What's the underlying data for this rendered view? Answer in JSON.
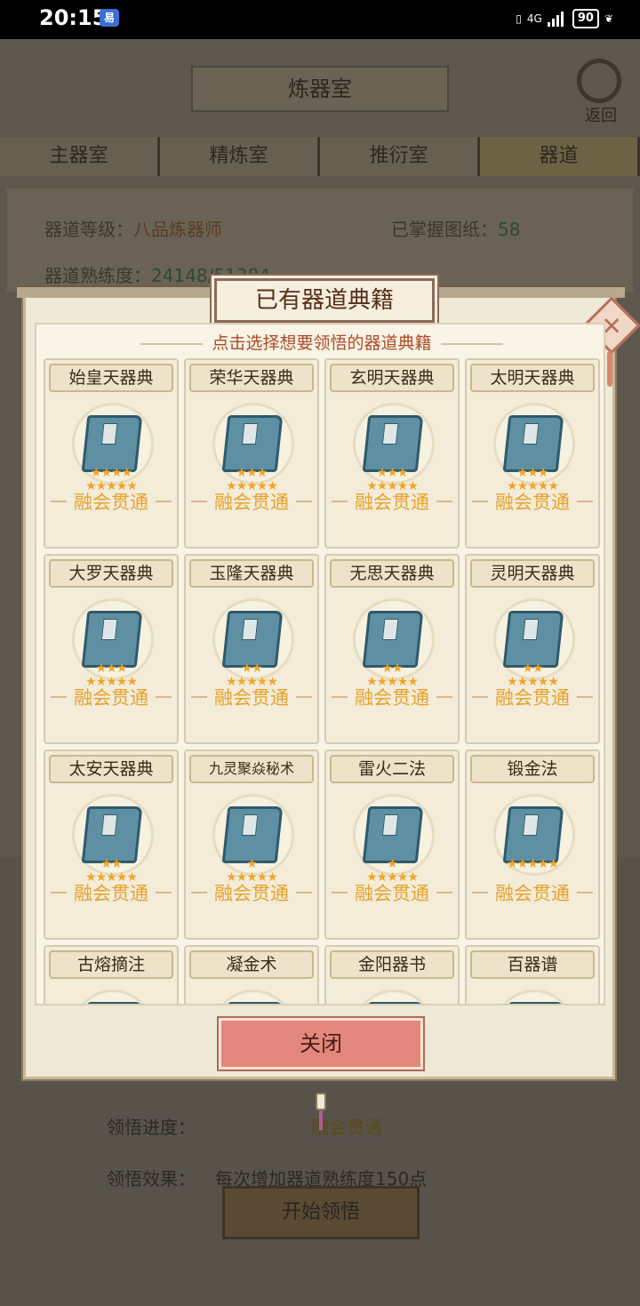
{
  "status_bar": {
    "time": "20:15",
    "app_badge": "易",
    "network": "4G",
    "battery": "90"
  },
  "background": {
    "title": "炼器室",
    "back_label": "返回",
    "tabs": [
      "主器室",
      "精炼室",
      "推衍室",
      "器道"
    ],
    "level_label": "器道等级：",
    "level_value": "八品炼器师",
    "blueprint_label": "已掌握图纸：",
    "blueprint_value": "58",
    "proficiency_label": "器道熟练度：",
    "proficiency_value": "24148/51384",
    "progress_label": "领悟进度：",
    "progress_value": "融会贯通",
    "effect_label": "领悟效果：",
    "effect_value": "每次增加器道熟练度150点",
    "start_button": "开始领悟"
  },
  "dialog": {
    "title": "已有器道典籍",
    "subtitle": "点击选择想要领悟的器道典籍",
    "close_button": "关闭",
    "books": [
      {
        "name": "始皇天器典",
        "stars_top": "★★★★",
        "stars_bottom": "★★★★★",
        "status": "融会贯通"
      },
      {
        "name": "荣华天器典",
        "stars_top": "★★★",
        "stars_bottom": "★★★★★",
        "status": "融会贯通"
      },
      {
        "name": "玄明天器典",
        "stars_top": "★★★",
        "stars_bottom": "★★★★★",
        "status": "融会贯通"
      },
      {
        "name": "太明天器典",
        "stars_top": "★★★",
        "stars_bottom": "★★★★★",
        "status": "融会贯通"
      },
      {
        "name": "大罗天器典",
        "stars_top": "★★★",
        "stars_bottom": "★★★★★",
        "status": "融会贯通"
      },
      {
        "name": "玉隆天器典",
        "stars_top": "★★",
        "stars_bottom": "★★★★★",
        "status": "融会贯通"
      },
      {
        "name": "无思天器典",
        "stars_top": "★★",
        "stars_bottom": "★★★★★",
        "status": "融会贯通"
      },
      {
        "name": "灵明天器典",
        "stars_top": "★★",
        "stars_bottom": "★★★★★",
        "status": "融会贯通"
      },
      {
        "name": "太安天器典",
        "stars_top": "★★",
        "stars_bottom": "★★★★★",
        "status": "融会贯通"
      },
      {
        "name": "九灵聚焱秘术",
        "stars_top": "★",
        "stars_bottom": "★★★★★",
        "status": "融会贯通"
      },
      {
        "name": "雷火二法",
        "stars_top": "★",
        "stars_bottom": "★★★★★",
        "status": "融会贯通"
      },
      {
        "name": "锻金法",
        "stars_top": "",
        "stars_bottom": "★★★★★",
        "status": "融会贯通"
      },
      {
        "name": "古熔摘注",
        "stars_top": "",
        "stars_bottom": "",
        "status": ""
      },
      {
        "name": "凝金术",
        "stars_top": "",
        "stars_bottom": "",
        "status": ""
      },
      {
        "name": "金阳器书",
        "stars_top": "",
        "stars_bottom": "",
        "status": ""
      },
      {
        "name": "百器谱",
        "stars_top": "",
        "stars_bottom": "",
        "status": ""
      }
    ]
  }
}
